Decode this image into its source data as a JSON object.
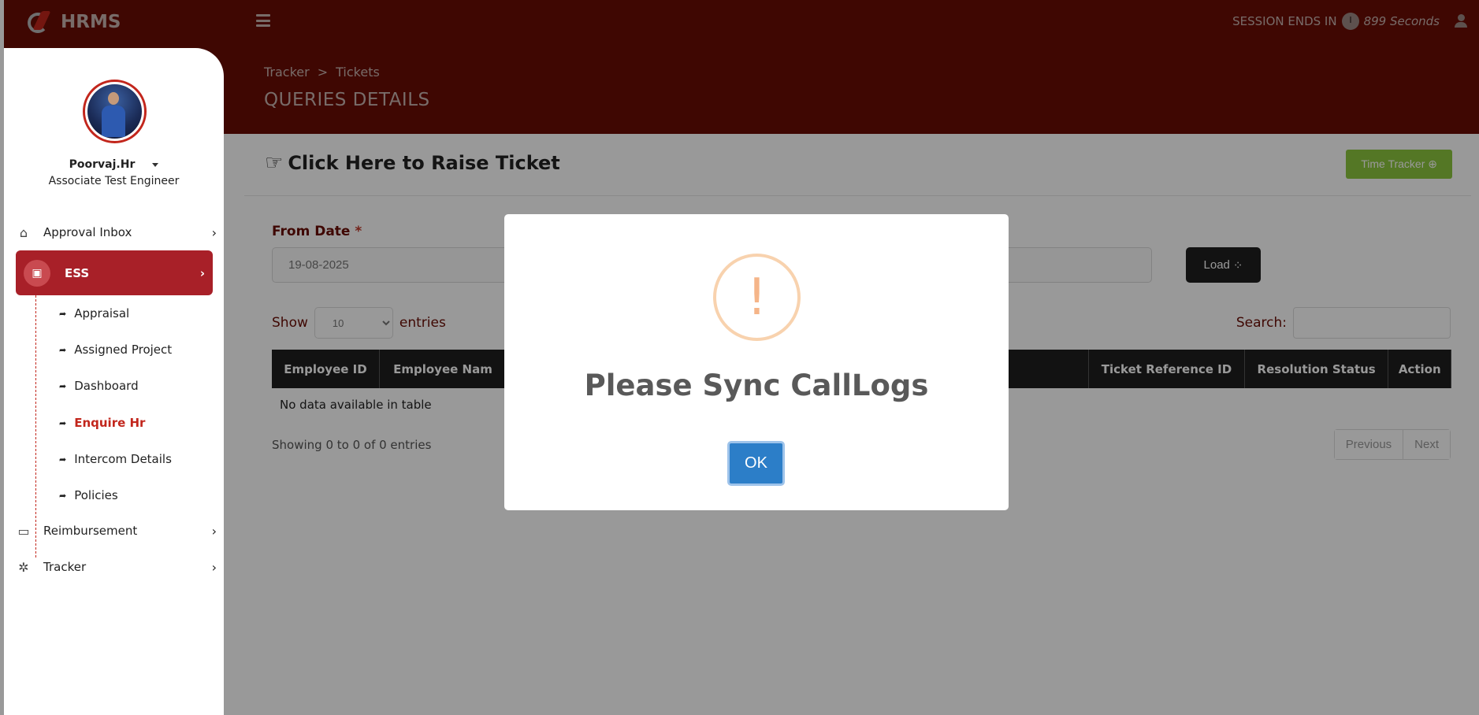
{
  "app": {
    "name": "HRMS"
  },
  "header": {
    "session_label": "SESSION ENDS IN",
    "session_seconds": "899 Seconds"
  },
  "sidebar": {
    "user_name": "Poorvaj.Hr",
    "user_role": "Associate Test Engineer",
    "items": [
      {
        "label": "Approval Inbox",
        "icon": "home-icon"
      },
      {
        "label": "ESS",
        "icon": "monitor-user-icon"
      },
      {
        "label": "Reimbursement",
        "icon": "money-icon"
      },
      {
        "label": "Tracker",
        "icon": "cog-icon"
      }
    ],
    "ess_sub": [
      {
        "label": "Appraisal"
      },
      {
        "label": "Assigned Project"
      },
      {
        "label": "Dashboard"
      },
      {
        "label": "Enquire Hr"
      },
      {
        "label": "Intercom Details"
      },
      {
        "label": "Policies"
      }
    ]
  },
  "breadcrumb": {
    "parent": "Tracker",
    "current": "Tickets",
    "separator": ">"
  },
  "page_title": "QUERIES DETAILS",
  "card": {
    "title": "Click Here to Raise Ticket",
    "time_tracker_label": "Time Tracker",
    "from_date_label": "From Date",
    "required_mark": "*",
    "from_date_value": "19-08-2025",
    "load_label": "Load",
    "show_label": "Show",
    "entries_label": "entries",
    "page_size": "10",
    "search_label": "Search:",
    "columns": [
      "Employee ID",
      "Employee Nam",
      "Ticket Reference ID",
      "Resolution Status",
      "Action"
    ],
    "empty_text": "No data available in table",
    "showing_text": "Showing 0 to 0 of 0 entries",
    "prev_label": "Previous",
    "next_label": "Next"
  },
  "modal": {
    "icon": "exclamation-icon",
    "title": "Please Sync CallLogs",
    "ok_label": "OK"
  },
  "colors": {
    "header_bg": "#690c04",
    "active_nav": "#a82028",
    "ok_button": "#2c7ec8",
    "time_tracker": "#8dc63f"
  }
}
